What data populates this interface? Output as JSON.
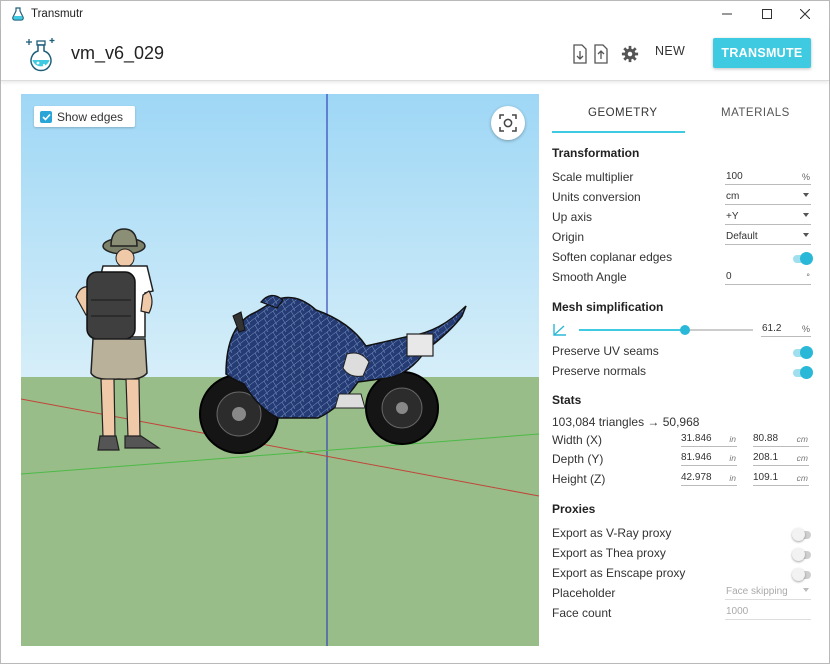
{
  "window": {
    "title": "Transmutr",
    "minimize": "—",
    "maximize": "☐",
    "close": "✕"
  },
  "header": {
    "file_name": "vm_v6_029",
    "new_label": "NEW",
    "transmute_label": "TRANSMUTE",
    "accent_color": "#3ecbe2"
  },
  "viewport": {
    "show_edges_label": "Show edges",
    "show_edges_checked": true
  },
  "tabs": {
    "geometry": "GEOMETRY",
    "materials": "MATERIALS",
    "active": "GEOMETRY"
  },
  "transformation": {
    "title": "Transformation",
    "scale_label": "Scale multiplier",
    "scale_value": "100",
    "scale_suffix": "%",
    "units_label": "Units conversion",
    "units_value": "cm",
    "upaxis_label": "Up axis",
    "upaxis_value": "+Y",
    "origin_label": "Origin",
    "origin_value": "Default",
    "soften_label": "Soften coplanar edges",
    "soften_on": true,
    "smooth_label": "Smooth Angle",
    "smooth_value": "0",
    "smooth_suffix": "°"
  },
  "mesh": {
    "title": "Mesh simplification",
    "slider_percent": 61.2,
    "slider_value": "61.2",
    "slider_suffix": "%",
    "uv_label": "Preserve UV seams",
    "uv_on": true,
    "normals_label": "Preserve normals",
    "normals_on": true
  },
  "stats": {
    "title": "Stats",
    "triangles": "103,084 triangles → 50,968",
    "width_label": "Width (X)",
    "width_in": "31.846",
    "width_cm": "80.88",
    "depth_label": "Depth (Y)",
    "depth_in": "81.946",
    "depth_cm": "208.1",
    "height_label": "Height (Z)",
    "height_in": "42.978",
    "height_cm": "109.1",
    "unit_in": "in",
    "unit_cm": "cm"
  },
  "proxies": {
    "title": "Proxies",
    "vray_label": "Export as V-Ray proxy",
    "vray_on": false,
    "thea_label": "Export as Thea proxy",
    "thea_on": false,
    "enscape_label": "Export as Enscape proxy",
    "enscape_on": false,
    "placeholder_label": "Placeholder",
    "placeholder_value": "Face skipping",
    "facecount_label": "Face count",
    "facecount_value": "1000"
  }
}
